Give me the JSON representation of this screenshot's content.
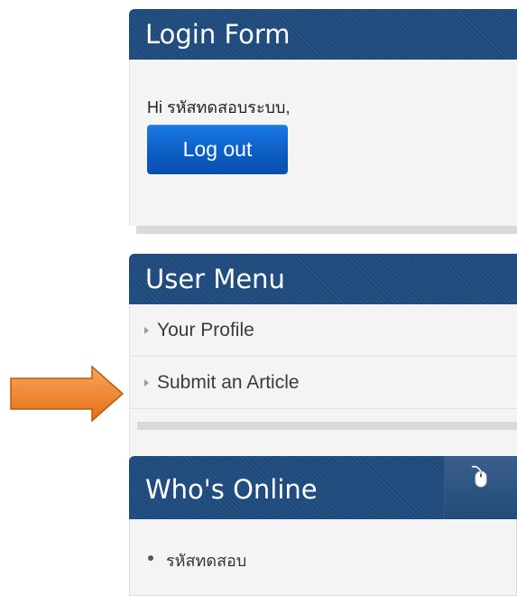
{
  "login_module": {
    "title": "Login Form",
    "greeting": "Hi รหัสทดสอบระบบ,",
    "logout_label": "Log out"
  },
  "user_menu": {
    "title": "User Menu",
    "items": [
      {
        "label": "Your Profile"
      },
      {
        "label": "Submit an Article"
      }
    ]
  },
  "whos_online": {
    "title": "Who's Online",
    "icon": "mouse-icon",
    "users": [
      {
        "name": "รหัสทดสอบ"
      }
    ]
  },
  "annotation": {
    "icon": "orange-arrow-icon",
    "color": "#f0862e"
  },
  "colors": {
    "header": "#1f4a7c",
    "button": "#0d5ec5",
    "body": "#f4f4f4"
  }
}
